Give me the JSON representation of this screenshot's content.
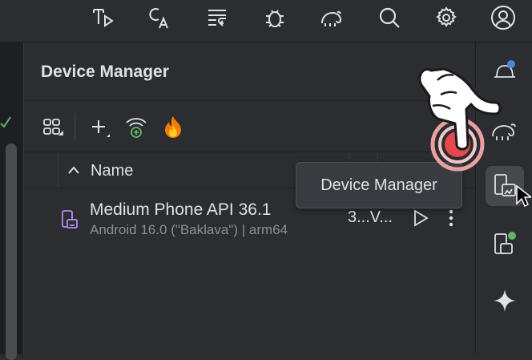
{
  "top_toolbar": {
    "icons": [
      "tip-run-icon",
      "translate-icon",
      "wrap-lines-icon",
      "bug-icon",
      "elephant-sync-icon",
      "search-icon",
      "gear-icon",
      "account-icon"
    ]
  },
  "device_manager": {
    "title": "Device Manager",
    "toolbar": [
      "device-groups-icon",
      "add-device-icon",
      "pair-wifi-icon",
      "firebase-icon"
    ],
    "table": {
      "columns": [
        {
          "label": "Name",
          "sort": "ascending"
        }
      ],
      "rows": [
        {
          "name": "Medium Phone API 36.1",
          "subtitle": "Android 16.0 (\"Baklava\") | arm64",
          "status": "3...V...",
          "actions": [
            "run-icon",
            "more-icon"
          ]
        }
      ]
    }
  },
  "right_sidebar": {
    "items": [
      "notifications-icon",
      "gradle-icon",
      "device-manager-icon",
      "running-devices-icon",
      "gemini-icon"
    ],
    "active": "device-manager-icon"
  },
  "tooltip": {
    "text": "Device Manager"
  },
  "colors": {
    "background": "#2b2d30",
    "accent_blue": "#4a86e8",
    "click_red": "#e5484d",
    "device_icon": "#b58cf0"
  }
}
